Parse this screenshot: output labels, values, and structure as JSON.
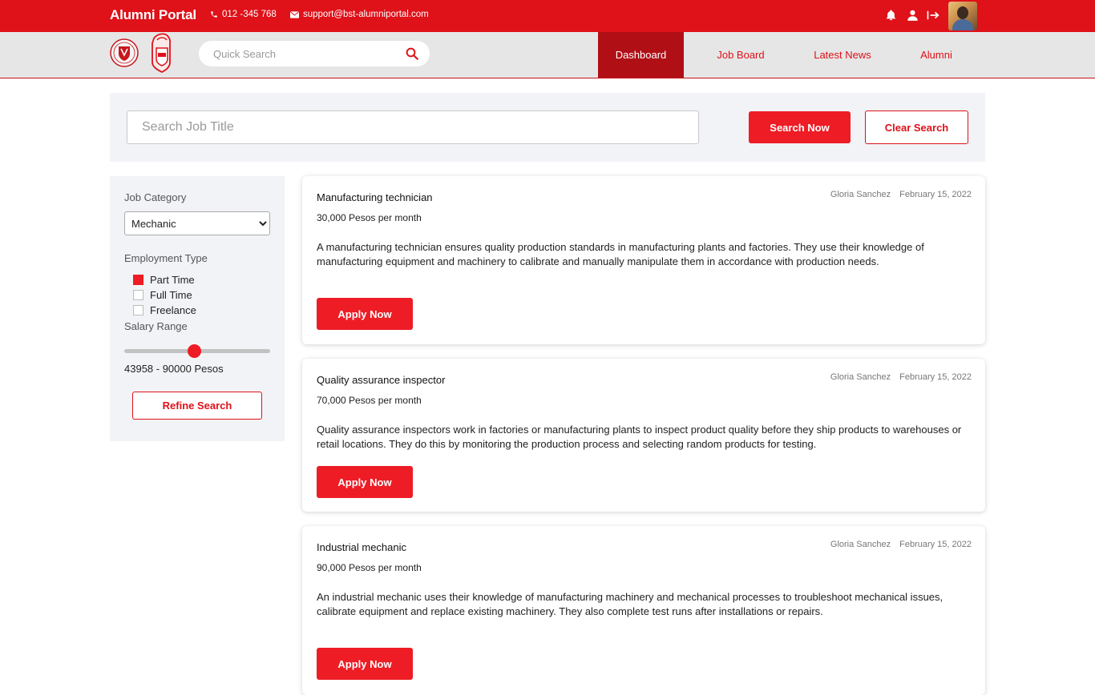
{
  "header": {
    "brand": "Alumni Portal",
    "phone": "012 -345 768",
    "email": "support@bst-alumniportal.com",
    "icons": [
      "bell-icon",
      "user-icon",
      "logout-icon"
    ]
  },
  "nav": {
    "quick_search_placeholder": "Quick Search",
    "tabs": [
      {
        "label": "Dashboard",
        "active": true
      },
      {
        "label": "Job Board",
        "active": false
      },
      {
        "label": "Latest News",
        "active": false
      },
      {
        "label": "Alumni",
        "active": false
      }
    ]
  },
  "search": {
    "placeholder": "Search Job Title",
    "search_label": "Search Now",
    "clear_label": "Clear Search"
  },
  "filters": {
    "category_label": "Job Category",
    "category_value": "Mechanic",
    "employment_label": "Employment Type",
    "types": [
      {
        "label": "Part Time",
        "checked": true
      },
      {
        "label": "Full Time",
        "checked": false
      },
      {
        "label": "Freelance",
        "checked": false
      }
    ],
    "salary_label": "Salary Range",
    "salary_fraction": 0.48,
    "salary_text": "43958 - 90000 Pesos",
    "refine_label": "Refine Search"
  },
  "jobs": [
    {
      "title": "Manufacturing technician",
      "author": "Gloria Sanchez",
      "date": "February 15, 2022",
      "salary": "30,000 Pesos per month",
      "description": "A manufacturing technician ensures quality production standards in manufacturing plants and factories. They use their knowledge of manufacturing equipment and machinery to calibrate and manually manipulate them in accordance with production needs.",
      "apply_label": "Apply Now"
    },
    {
      "title": "Quality assurance inspector",
      "author": "Gloria Sanchez",
      "date": "February 15, 2022",
      "salary": "70,000 Pesos per month",
      "description": "Quality assurance inspectors work in factories or manufacturing plants to inspect product quality before they ship products to warehouses or retail locations. They do this by monitoring the production process and selecting random products for testing.",
      "apply_label": "Apply Now"
    },
    {
      "title": "Industrial mechanic",
      "author": "Gloria Sanchez",
      "date": "February 15, 2022",
      "salary": "90,000 Pesos per month",
      "description": "An industrial mechanic uses their knowledge of manufacturing machinery and mechanical processes to troubleshoot mechanical issues, calibrate equipment and replace existing machinery. They also complete test runs after installations or repairs.",
      "apply_label": "Apply Now"
    }
  ],
  "colors": {
    "brand_red": "#df1119",
    "button_red": "#ee1c25",
    "active_tab": "#b00f16"
  }
}
